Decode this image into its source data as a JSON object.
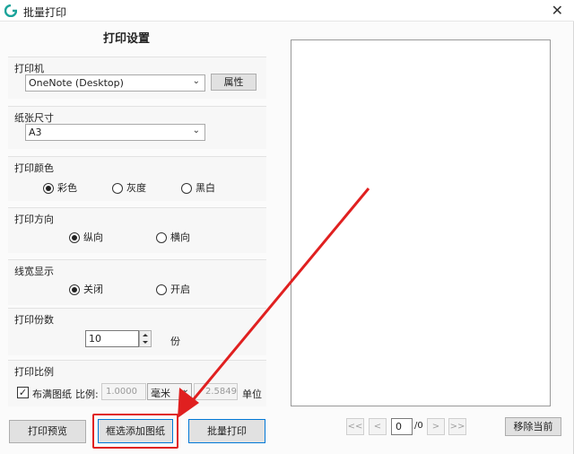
{
  "window": {
    "title": "批量打印",
    "close_glyph": "✕"
  },
  "settings_title": "打印设置",
  "printer": {
    "label": "打印机",
    "selected": "OneNote (Desktop)",
    "properties_button": "属性"
  },
  "paper": {
    "label": "纸张尺寸",
    "selected": "A3"
  },
  "color": {
    "label": "打印颜色",
    "options": [
      "彩色",
      "灰度",
      "黑白"
    ],
    "selected_index": 0
  },
  "orientation": {
    "label": "打印方向",
    "options": [
      "纵向",
      "横向"
    ],
    "selected_index": 0
  },
  "line_width": {
    "label": "线宽显示",
    "options": [
      "关闭",
      "开启"
    ],
    "selected_index": 0
  },
  "copies": {
    "label": "打印份数",
    "value": "10",
    "unit": "份"
  },
  "scale": {
    "label": "打印比例",
    "fit_paper_label": "布满图纸",
    "fit_paper_checked": true,
    "ratio_label": "比例:",
    "ratio_value": "1.0000",
    "unit_selected": "毫米",
    "second_value": "2.5849",
    "unit_label": "单位"
  },
  "buttons": {
    "preview": "打印预览",
    "add_by_selection": "框选添加图纸",
    "batch_print": "批量打印",
    "remove_current": "移除当前"
  },
  "pager": {
    "first": "<<",
    "prev": "<",
    "current": "0",
    "total": "/0",
    "next": ">",
    "last": ">>"
  },
  "colors": {
    "highlight_red": "#e02020"
  },
  "icons": {
    "app": "app-logo-icon",
    "close": "close-icon",
    "dropdown": "chevron-down-icon"
  }
}
